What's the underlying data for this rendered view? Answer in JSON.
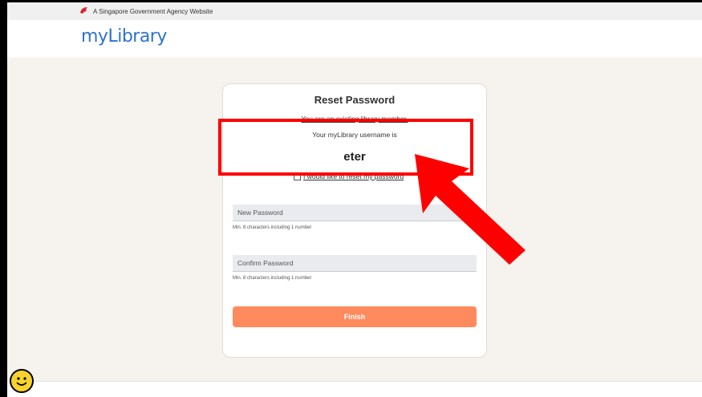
{
  "gov_banner": {
    "text": "A Singapore Government Agency Website"
  },
  "brand": {
    "logo_text": "myLibrary"
  },
  "card": {
    "title": "Reset Password",
    "existing_member": "You are an existing library member.",
    "username_label": "Your myLibrary username is",
    "username": "eter",
    "reset_checkbox_label": "I would like to reset my password",
    "new_password": {
      "placeholder": "New Password",
      "hint": "Min. 8 characters including 1 number"
    },
    "confirm_password": {
      "placeholder": "Confirm Password",
      "hint": "Min. 8 characters including 1 number"
    },
    "finish_label": "Finish"
  },
  "colors": {
    "brand_blue": "#2e73cc",
    "page_bg": "#f6f2ed",
    "finish_button": "#ff8a5e",
    "annotation_red": "#ff0000"
  },
  "icons": [
    "lion-head-icon",
    "smiley-face-icon",
    "annotation-arrow-icon"
  ]
}
